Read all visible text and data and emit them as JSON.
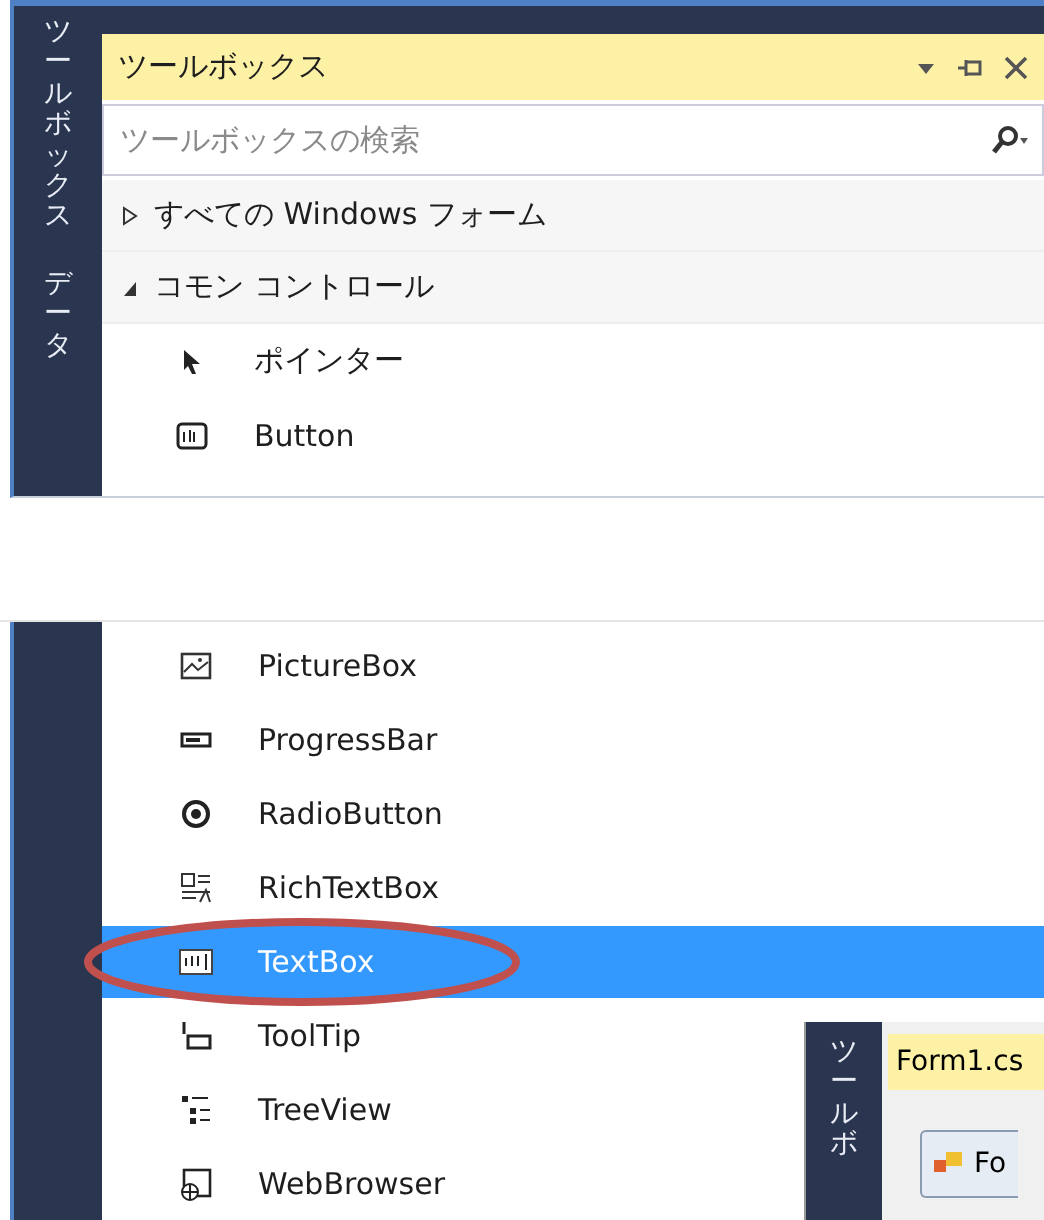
{
  "toolbox": {
    "side_tabs": [
      "ツールボックス",
      "データ"
    ],
    "title": "ツールボックス",
    "search": {
      "placeholder": "ツールボックスの検索"
    },
    "groups": [
      {
        "label": "すべての Windows フォーム",
        "expanded": false
      },
      {
        "label": "コモン コントロール",
        "expanded": true,
        "items": [
          {
            "label": "ポインター",
            "kind": "pointer",
            "selected": false
          },
          {
            "label": "Button",
            "kind": "button",
            "selected": false
          }
        ]
      }
    ]
  },
  "toolbox_lower": {
    "items": [
      {
        "label": "PictureBox",
        "kind": "picture",
        "selected": false
      },
      {
        "label": "ProgressBar",
        "kind": "progress",
        "selected": false
      },
      {
        "label": "RadioButton",
        "kind": "radio",
        "selected": false
      },
      {
        "label": "RichTextBox",
        "kind": "richtext",
        "selected": false
      },
      {
        "label": "TextBox",
        "kind": "textbox",
        "selected": true
      },
      {
        "label": "ToolTip",
        "kind": "tooltip",
        "selected": false
      },
      {
        "label": "TreeView",
        "kind": "tree",
        "selected": false
      },
      {
        "label": "WebBrowser",
        "kind": "browser",
        "selected": false
      }
    ]
  },
  "overlay_window": {
    "side_tab": "ツールボ",
    "tab": "Form1.cs",
    "button": "Fo"
  }
}
